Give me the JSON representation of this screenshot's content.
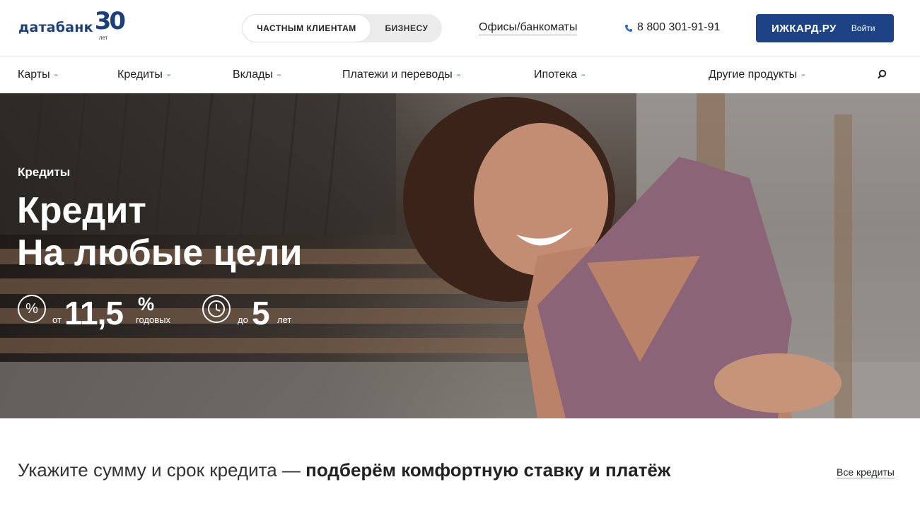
{
  "header": {
    "logo_text": "датабанк",
    "logo_badge_number": "30",
    "logo_badge_caption": "лет",
    "segments": [
      {
        "label": "ЧАСТНЫМ КЛИЕНТАМ",
        "active": true
      },
      {
        "label": "БИЗНЕСУ",
        "active": false
      }
    ],
    "offices_link": "Офисы/банкоматы",
    "phone": "8 800 301-91-91",
    "login": {
      "brand": "ИЖКАРД.РУ",
      "label": "Войти"
    },
    "accent_color": "#1d4286"
  },
  "nav": {
    "items": [
      {
        "label": "Карты"
      },
      {
        "label": "Кредиты"
      },
      {
        "label": "Вклады"
      },
      {
        "label": "Платежи и переводы"
      },
      {
        "label": "Ипотека"
      },
      {
        "label": "Другие продукты"
      }
    ],
    "search_icon": "search-icon"
  },
  "hero": {
    "category": "Кредиты",
    "title_line1": "Кредит",
    "title_line2": "На любые цели",
    "rate": {
      "icon": "percent-icon",
      "icon_glyph": "%",
      "prefix": "от",
      "value": "11,5",
      "unit": "%",
      "suffix": "годовых"
    },
    "term": {
      "icon": "clock-icon",
      "prefix": "до",
      "value": "5",
      "suffix": "лет"
    }
  },
  "calculator": {
    "title_plain": "Укажите сумму и срок кредита — ",
    "title_bold": "подберём комфортную ставку и платёж",
    "all_link": "Все кредиты"
  }
}
